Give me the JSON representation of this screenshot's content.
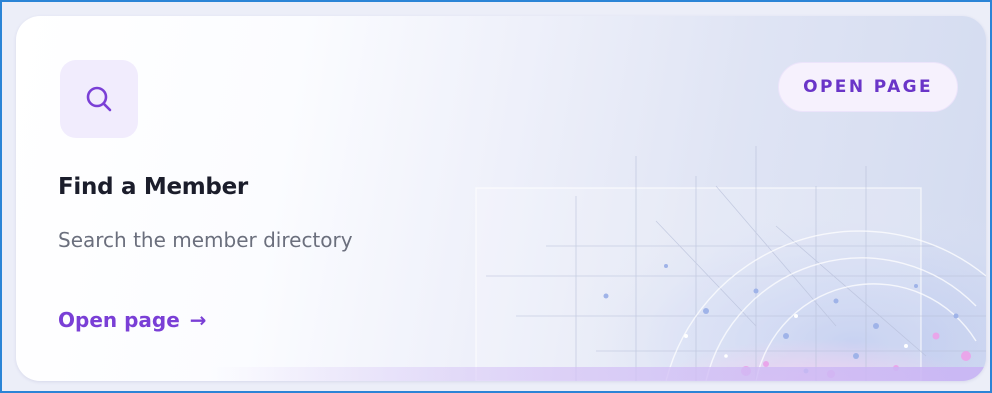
{
  "card": {
    "title": "Find a Member",
    "subtitle": "Search the member directory",
    "badge_label": "OPEN PAGE",
    "link_label": "Open page",
    "link_arrow": "→",
    "icon": "search-icon"
  },
  "colors": {
    "accent": "#7a3fd6",
    "badge_text": "#6a35c8",
    "icon_tile_bg": "#f1ecfd",
    "title": "#1b1d2b",
    "subtitle": "#6b6f7d",
    "frame_border": "#2b84d6"
  }
}
